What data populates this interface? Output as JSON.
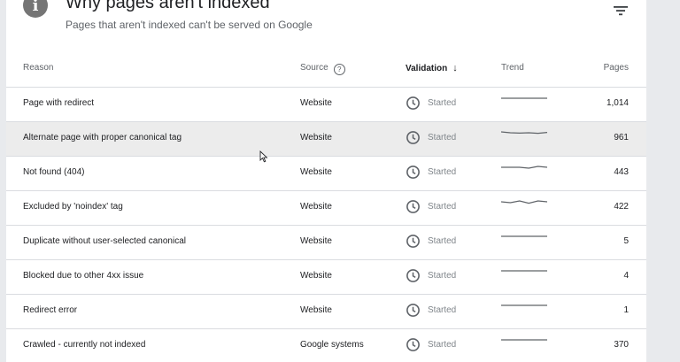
{
  "header": {
    "title": "Why pages aren't indexed",
    "subtitle": "Pages that aren't indexed can't be served on Google",
    "info_icon": "info-icon",
    "info_glyph": "i",
    "filter_icon": "filter-icon"
  },
  "table": {
    "columns": {
      "reason": "Reason",
      "source": "Source",
      "validation": "Validation",
      "trend": "Trend",
      "pages": "Pages"
    },
    "help_glyph": "?",
    "sort_glyph": "↓",
    "rows": [
      {
        "reason": "Page with redirect",
        "source": "Website",
        "validation": "Started",
        "pages": "1,014",
        "trend": [
          0.5,
          0.5,
          0.5,
          0.5,
          0.5,
          0.5
        ]
      },
      {
        "reason": "Alternate page with proper canonical tag",
        "source": "Website",
        "validation": "Started",
        "pages": "961",
        "trend": [
          0.55,
          0.5,
          0.48,
          0.5,
          0.47,
          0.52
        ]
      },
      {
        "reason": "Not found (404)",
        "source": "Website",
        "validation": "Started",
        "pages": "443",
        "trend": [
          0.5,
          0.5,
          0.5,
          0.45,
          0.55,
          0.5
        ]
      },
      {
        "reason": "Excluded by 'noindex' tag",
        "source": "Website",
        "validation": "Started",
        "pages": "422",
        "trend": [
          0.5,
          0.45,
          0.55,
          0.42,
          0.55,
          0.5
        ]
      },
      {
        "reason": "Duplicate without user-selected canonical",
        "source": "Website",
        "validation": "Started",
        "pages": "5",
        "trend": [
          0.5,
          0.5,
          0.5,
          0.5,
          0.5,
          0.5
        ]
      },
      {
        "reason": "Blocked due to other 4xx issue",
        "source": "Website",
        "validation": "Started",
        "pages": "4",
        "trend": [
          0.5,
          0.5,
          0.5,
          0.5,
          0.5,
          0.5
        ]
      },
      {
        "reason": "Redirect error",
        "source": "Website",
        "validation": "Started",
        "pages": "1",
        "trend": [
          0.5,
          0.5,
          0.5,
          0.5,
          0.5,
          0.5
        ]
      },
      {
        "reason": "Crawled - currently not indexed",
        "source": "Google systems",
        "validation": "Started",
        "pages": "370",
        "trend": [
          0.5,
          0.5,
          0.5,
          0.5,
          0.5,
          0.5
        ]
      }
    ]
  },
  "colors": {
    "highlight_row": "#ececec",
    "muted_text": "#80868b",
    "trend_line": "#5f6368"
  }
}
